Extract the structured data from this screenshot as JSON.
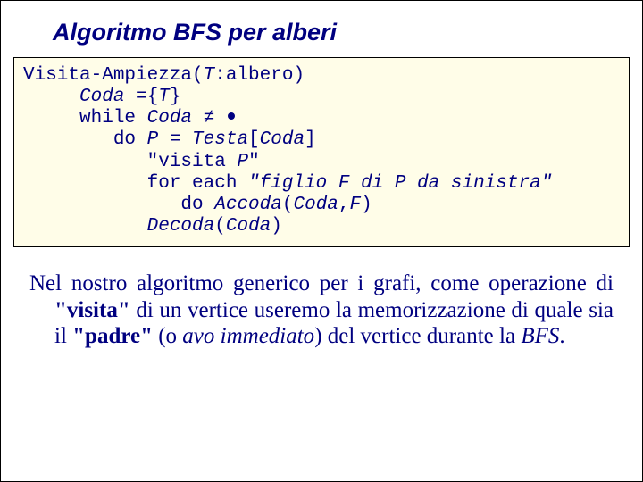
{
  "title": "Algoritmo BFS per alberi",
  "code": {
    "l1a": "Visita-Ampiezza(",
    "l1b": "T",
    "l1c": ":albero)",
    "l2a": "     Coda ",
    "l2b": "=",
    "l2c": "{",
    "l2d": "T",
    "l2e": "}",
    "l3a": "     while ",
    "l3b": "Coda ",
    "l3c": "≠",
    "l4a": "        do ",
    "l4b": "P = Testa",
    "l4c": "[",
    "l4d": "Coda",
    "l4e": "]",
    "l5a": "           ",
    "l5b": "\"visita ",
    "l5c": "P",
    "l5d": "\"",
    "l6a": "           for each ",
    "l6b": "\"figlio F di P da sinistra\"",
    "l7a": "              do ",
    "l7b": "Accoda",
    "l7c": "(",
    "l7d": "Coda",
    "l7e": ",",
    "l7f": "F",
    "l7g": ")",
    "l8a": "           ",
    "l8b": "Decoda",
    "l8c": "(",
    "l8d": "Coda",
    "l8e": ")"
  },
  "para": {
    "t1": "Nel nostro algoritmo generico per i grafi, come operazione di ",
    "q1": "\"visita\"",
    "t2": " di un vertice useremo la me­morizzazione di quale sia il ",
    "q2": "\"padre\"",
    "t3": " (o ",
    "ital1": "avo imme­diato",
    "t4": ") del vertice durante la ",
    "ital2": "BFS",
    "t5": "."
  }
}
